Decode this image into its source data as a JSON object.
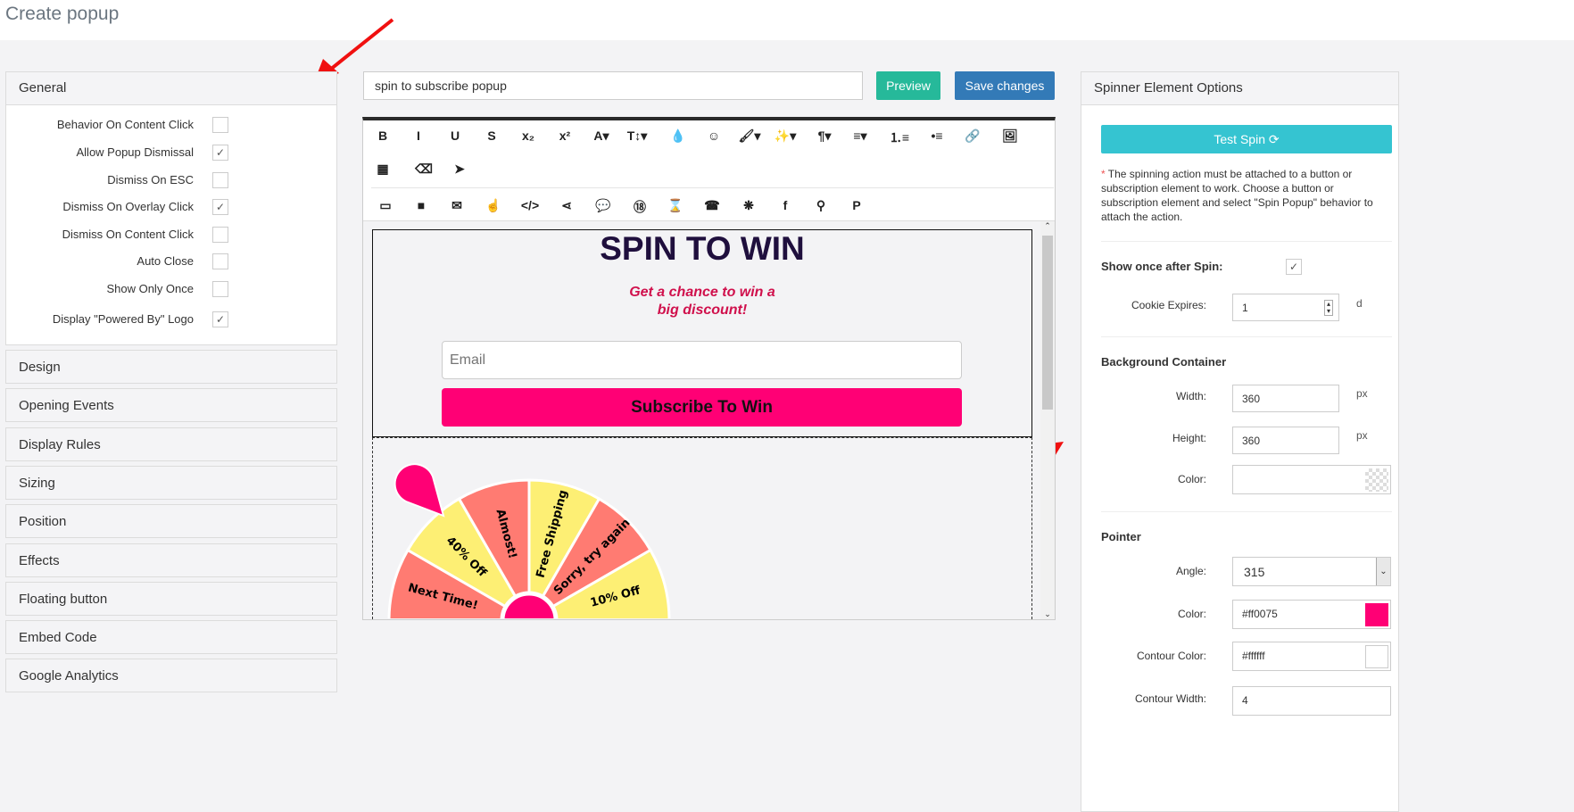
{
  "page": {
    "title": "Create popup"
  },
  "left": {
    "general_label": "General",
    "options": [
      {
        "label": "Behavior On Content Click",
        "checked": false
      },
      {
        "label": "Allow Popup Dismissal",
        "checked": true
      },
      {
        "label": "Dismiss On ESC",
        "checked": false
      },
      {
        "label": "Dismiss On Overlay Click",
        "checked": true
      },
      {
        "label": "Dismiss On Content Click",
        "checked": false
      },
      {
        "label": "Auto Close",
        "checked": false
      },
      {
        "label": "Show Only Once",
        "checked": false
      },
      {
        "label": "Display \"Powered By\" Logo",
        "checked": true
      }
    ],
    "sections": [
      "Design",
      "Opening Events",
      "Display Rules",
      "Sizing",
      "Position",
      "Effects",
      "Floating button",
      "Embed Code",
      "Google Analytics"
    ]
  },
  "center": {
    "name_value": "spin to subscribe popup",
    "preview_label": "Preview",
    "save_label": "Save changes",
    "toolbar_row1": [
      "B",
      "I",
      "U",
      "S",
      "x₂",
      "x²",
      "A▾",
      "T↕▾",
      "💧",
      "☺",
      "🖌▾",
      "✨▾",
      "¶▾",
      "≡▾",
      "⒈≡",
      "•≡",
      "🔗",
      "🖼"
    ],
    "toolbar_row2": [
      "▦",
      "⌫",
      "➤"
    ],
    "toolbar_row3": [
      "▭",
      "■",
      "✉",
      "☝",
      "</>",
      "⋖",
      "💬",
      "⑱",
      "⌛",
      "☎",
      "❋",
      "f",
      "⚲",
      "P"
    ],
    "popup": {
      "heading": "SPIN TO WIN",
      "subheading_1": "Get a chance to win a",
      "subheading_2": "big discount!",
      "email_placeholder": "Email",
      "subscribe_label": "Subscribe To Win",
      "wheel_labels": [
        {
          "text": "Free Shipping",
          "angle": 15
        },
        {
          "text": "Sorry, try again",
          "angle": 45
        },
        {
          "text": "10% Off",
          "angle": 75
        },
        {
          "text": "Next Time!",
          "angle": -75
        },
        {
          "text": "40% Off",
          "angle": -45
        },
        {
          "text": "Almost!",
          "angle": -15
        }
      ],
      "colors": {
        "accent": "#ff0075",
        "salmon": "#ff7b72",
        "yellow": "#fdef74",
        "heading": "#1f0f3d",
        "subheading": "#d0104c"
      }
    }
  },
  "right": {
    "header": "Spinner Element Options",
    "test_spin_label": "Test Spin ⟳",
    "note_star": "*",
    "note": "The spinning action must be attached to a button or subscription element to work. Choose a button or subscription element and select \"Spin Popup\" behavior to attach the action.",
    "show_once_label": "Show once after Spin:",
    "show_once_checked": true,
    "cookie_label": "Cookie Expires:",
    "cookie_value": "1",
    "cookie_unit": "d",
    "bg_section": "Background Container",
    "width_label": "Width:",
    "width_value": "360",
    "width_unit": "px",
    "height_label": "Height:",
    "height_value": "360",
    "height_unit": "px",
    "color_label": "Color:",
    "pointer_section": "Pointer",
    "angle_label": "Angle:",
    "angle_value": "315",
    "pcolor_label": "Color:",
    "pcolor_value": "#ff0075",
    "contour_label": "Contour Color:",
    "contour_value": "#ffffff",
    "contour_width_label": "Contour Width:",
    "contour_width_value": "4"
  }
}
